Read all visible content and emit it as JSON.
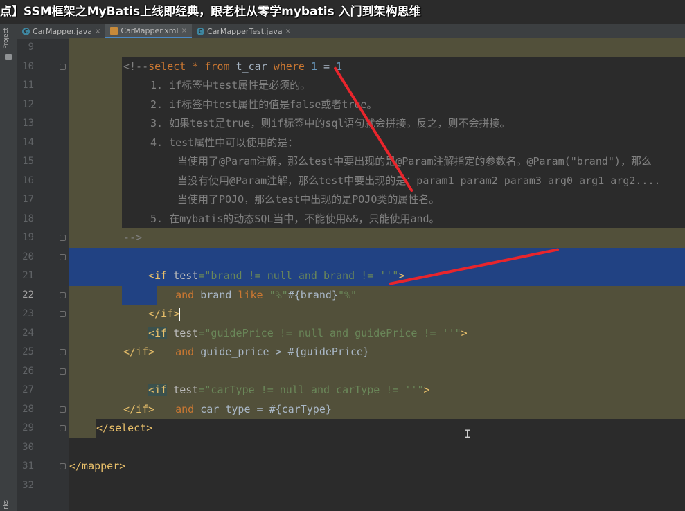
{
  "video_title": "点】SSM框架之MyBatis上线即经典，跟老杜从零学mybatis 入门到架构思维",
  "left_strip": {
    "top_label": "Project",
    "bottom_label": "rks"
  },
  "tabs": [
    {
      "label": "CarMapper.java",
      "icon": "java-class-icon",
      "active": false
    },
    {
      "label": "CarMapper.xml",
      "icon": "xml-file-icon",
      "active": true
    },
    {
      "label": "CarMapperTest.java",
      "icon": "test-class-icon",
      "active": false
    }
  ],
  "tab_close_glyph": "×",
  "line_numbers": [
    "9",
    "10",
    "11",
    "12",
    "13",
    "14",
    "15",
    "16",
    "17",
    "18",
    "19",
    "20",
    "21",
    "22",
    "23",
    "24",
    "25",
    "26",
    "27",
    "28",
    "29",
    "30",
    "31",
    "32"
  ],
  "current_line": "22",
  "code": {
    "l9": {
      "select": "select",
      "star": "*",
      "from": "from",
      "table": "t_car",
      "where": "where",
      "n1": "1",
      "eq": "=",
      "n2": "1"
    },
    "l10": "<!--",
    "l11": "1. if标签中test属性是必须的。",
    "l12": "2. if标签中test属性的值是false或者true。",
    "l13": "3. 如果test是true，则if标签中的sql语句就会拼接。反之，则不会拼接。",
    "l14": "4. test属性中可以使用的是：",
    "l15": "当使用了@Param注解，那么test中要出现的是@Param注解指定的参数名。@Param(\"brand\")，那么",
    "l16": "当没有使用@Param注解，那么test中要出现的是：param1 param2 param3 arg0 arg1 arg2....",
    "l17": "当使用了POJO，那么test中出现的是POJO类的属性名。",
    "l18": "5. 在mybatis的动态SQL当中，不能使用&&，只能使用and。",
    "l19": "-->",
    "l20": {
      "open": "<",
      "tag": "if",
      "attr": "test",
      "eq": "=",
      "value": "\"brand != null and brand != ''\"",
      "close": ">"
    },
    "l21": {
      "and": "and",
      "col": "brand",
      "like": "like",
      "s1": "\"%\"",
      "param": "#{brand}",
      "s2": "\"%\""
    },
    "l22": {
      "text": "</if>"
    },
    "l23": {
      "open": "<",
      "tag": "if",
      "attr": "test",
      "eq": "=",
      "value": "\"guidePrice != null and guidePrice != ''\"",
      "close": ">"
    },
    "l24": {
      "and": "and",
      "rest": "guide_price > #{guidePrice}"
    },
    "l25": "</if>",
    "l26": {
      "open": "<",
      "tag": "if",
      "attr": "test",
      "eq": "=",
      "value": "\"carType != null and carType != ''\"",
      "close": ">"
    },
    "l27": {
      "and": "and",
      "rest": "car_type = #{carType}"
    },
    "l28": "</if>",
    "l29": "</select>",
    "l31": "</mapper>"
  },
  "colors": {
    "keyword": "#cc7832",
    "tag": "#e8bf6a",
    "string": "#6a8759",
    "number": "#6897bb",
    "comment": "#808080",
    "selection": "#214283",
    "scope_highlight": "#52503a",
    "annotation_stroke": "#e8252c"
  }
}
